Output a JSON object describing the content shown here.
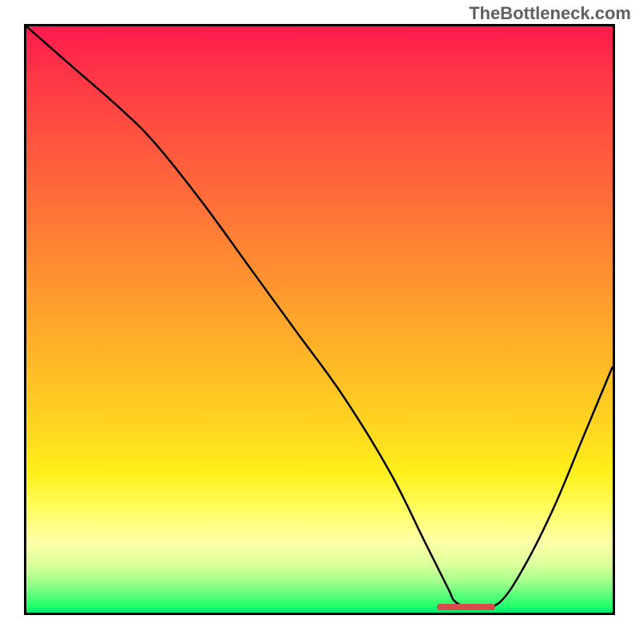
{
  "watermark": "TheBottleneck.com",
  "chart_data": {
    "type": "line",
    "title": "",
    "xlabel": "",
    "ylabel": "",
    "xlim": [
      0,
      100
    ],
    "ylim": [
      0,
      100
    ],
    "grid": false,
    "series": [
      {
        "name": "curve",
        "x": [
          0,
          8,
          16,
          22,
          30,
          38,
          46,
          54,
          62,
          68,
          72,
          73,
          75,
          78,
          81,
          85,
          90,
          95,
          100
        ],
        "values": [
          100,
          93,
          86,
          80,
          70,
          59,
          48,
          37,
          24,
          12,
          4,
          2,
          1,
          1,
          2,
          8,
          18,
          30,
          42
        ]
      }
    ],
    "marker": {
      "x_start": 70,
      "x_end": 80,
      "y": 1,
      "color": "#d94a4a"
    },
    "gradient_colors": {
      "top": "#ff1a4d",
      "mid1": "#ff8533",
      "mid2": "#ffef1a",
      "bottom": "#00e676"
    }
  }
}
